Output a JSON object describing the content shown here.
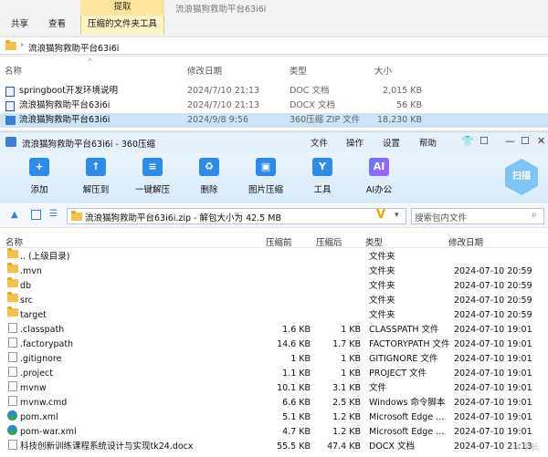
{
  "explorer": {
    "tabs": [
      "共享",
      "查看"
    ],
    "extract_label": "提取",
    "tool_tab": "压缩的文件夹工具",
    "window_title": "流浪猫狗救助平台63i6i",
    "breadcrumb": "流浪猫狗救助平台63i6i",
    "columns": {
      "name": "名称",
      "date": "修改日期",
      "type": "类型",
      "size": "大小"
    },
    "files": [
      {
        "name": "springboot开发环境说明",
        "date": "2024/7/10 21:13",
        "type": "DOC 文档",
        "size": "2,015 KB"
      },
      {
        "name": "流浪猫狗救助平台63i6i",
        "date": "2024/7/10 21:13",
        "type": "DOCX 文档",
        "size": "56 KB"
      },
      {
        "name": "流浪猫狗救助平台63i6i",
        "date": "2024/9/8 9:56",
        "type": "360压缩 ZIP 文件",
        "size": "18,230 KB"
      }
    ]
  },
  "zip": {
    "title": "流浪猫狗救助平台63i6i - 360压缩",
    "menus": [
      "文件",
      "操作",
      "设置",
      "帮助"
    ],
    "toolbar": [
      "添加",
      "解压到",
      "一键解压",
      "删除",
      "图片压缩",
      "工具",
      "AI办公"
    ],
    "scan_label": "扫描",
    "path": "流浪猫狗救助平台63i6i.zip - 解包大小为 42.5 MB",
    "search_placeholder": "搜索包内文件",
    "columns": {
      "name": "名称",
      "packed": "压缩前",
      "compressed": "压缩后",
      "type": "类型",
      "date": "修改日期"
    },
    "rows": [
      {
        "name": ".. (上级目录)",
        "packed": "",
        "compressed": "",
        "type": "文件夹",
        "date": "",
        "icon": "folder"
      },
      {
        "name": ".mvn",
        "packed": "",
        "compressed": "",
        "type": "文件夹",
        "date": "2024-07-10 20:59",
        "icon": "folder"
      },
      {
        "name": "db",
        "packed": "",
        "compressed": "",
        "type": "文件夹",
        "date": "2024-07-10 20:59",
        "icon": "folder"
      },
      {
        "name": "src",
        "packed": "",
        "compressed": "",
        "type": "文件夹",
        "date": "2024-07-10 20:59",
        "icon": "folder"
      },
      {
        "name": "target",
        "packed": "",
        "compressed": "",
        "type": "文件夹",
        "date": "2024-07-10 20:59",
        "icon": "folder"
      },
      {
        "name": ".classpath",
        "packed": "1.6 KB",
        "compressed": "1 KB",
        "type": "CLASSPATH 文件",
        "date": "2024-07-10 19:01",
        "icon": "file"
      },
      {
        "name": ".factorypath",
        "packed": "14.6 KB",
        "compressed": "1.7 KB",
        "type": "FACTORYPATH 文件",
        "date": "2024-07-10 19:01",
        "icon": "file"
      },
      {
        "name": ".gitignore",
        "packed": "1 KB",
        "compressed": "1 KB",
        "type": "GITIGNORE 文件",
        "date": "2024-07-10 19:01",
        "icon": "file"
      },
      {
        "name": ".project",
        "packed": "1.1 KB",
        "compressed": "1 KB",
        "type": "PROJECT 文件",
        "date": "2024-07-10 19:01",
        "icon": "file"
      },
      {
        "name": "mvnw",
        "packed": "10.1 KB",
        "compressed": "3.1 KB",
        "type": "文件",
        "date": "2024-07-10 19:01",
        "icon": "file"
      },
      {
        "name": "mvnw.cmd",
        "packed": "6.6 KB",
        "compressed": "2.5 KB",
        "type": "Windows 命令脚本",
        "date": "2024-07-10 19:01",
        "icon": "file"
      },
      {
        "name": "pom.xml",
        "packed": "5.1 KB",
        "compressed": "1.2 KB",
        "type": "Microsoft Edge ...",
        "date": "2024-07-10 19:01",
        "icon": "edge"
      },
      {
        "name": "pom-war.xml",
        "packed": "4.7 KB",
        "compressed": "1.2 KB",
        "type": "Microsoft Edge ...",
        "date": "2024-07-10 19:01",
        "icon": "edge"
      },
      {
        "name": "科技创新训练课程系统设计与实现tk24.docx",
        "packed": "55.5 KB",
        "compressed": "47.4 KB",
        "type": "DOCX 文档",
        "date": "2024-07-10 21:13",
        "icon": "file"
      }
    ]
  }
}
